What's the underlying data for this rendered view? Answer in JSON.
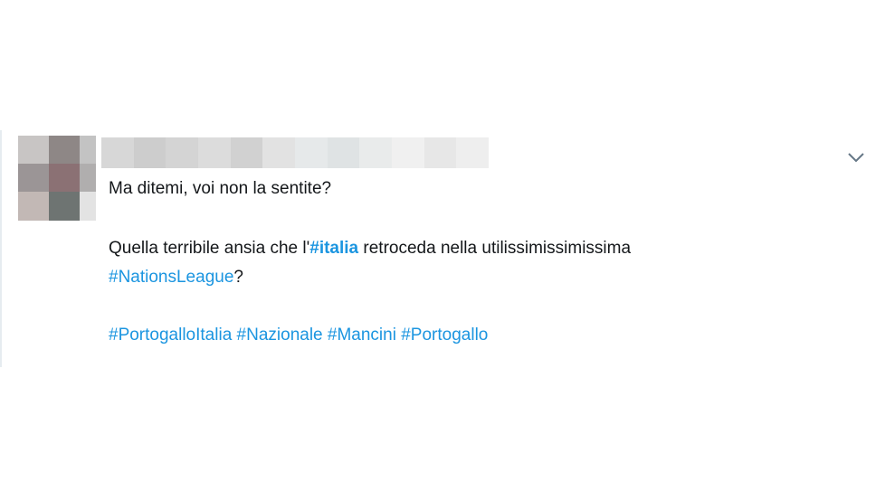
{
  "tweet": {
    "line1": "Ma ditemi, voi non la sentite?",
    "line2_prefix": "Quella terribile ansia che l'",
    "line2_hashtag": "#italia",
    "line2_suffix": " retroceda nella utilissimissimissima",
    "line3_hashtag": "#NationsLeague",
    "line3_suffix": "?",
    "tags": [
      "#PortogalloItalia",
      "#Nazionale",
      "#Mancini",
      "#Portogallo"
    ]
  },
  "icons": {
    "menu": "chevron-down-icon"
  },
  "colors": {
    "text": "#14171a",
    "link": "#1b95e0",
    "border": "#e6ecf0"
  }
}
